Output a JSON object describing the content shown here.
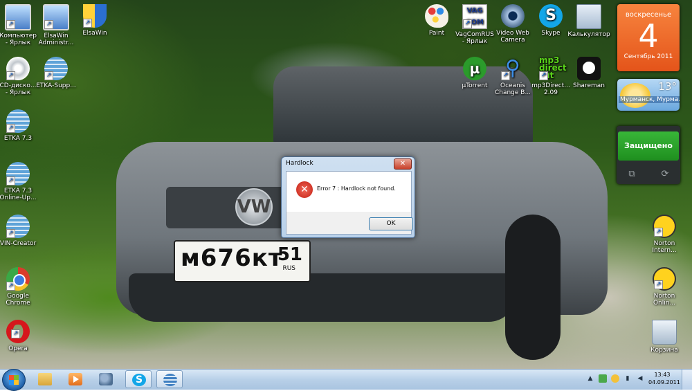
{
  "desktop": {
    "left_icons": [
      {
        "label": "Компьютер\n- Ярлык",
        "icon": "computer-icon"
      },
      {
        "label": "CD-диско...\n- Ярлык",
        "icon": "dvd-icon"
      },
      {
        "label": "ETKA 7.3",
        "icon": "etka-globe-icon"
      },
      {
        "label": "ETKA 7.3\nOnline-Up...",
        "icon": "etka-globe-icon"
      },
      {
        "label": "VIN-Creator",
        "icon": "etka-globe-icon"
      },
      {
        "label": "Google\nChrome",
        "icon": "chrome-icon"
      },
      {
        "label": "Opera",
        "icon": "opera-icon"
      }
    ],
    "elsawin_admin": {
      "label": "ElsaWin\nAdministr...",
      "icon": "elsawin-admin-icon"
    },
    "elsawin": {
      "label": "ElsaWin",
      "icon": "elsawin-shield-icon"
    },
    "etka_supp": {
      "label": "ETKA-Supp...",
      "icon": "etka-globe-icon"
    },
    "top_icons": [
      {
        "label": "Paint",
        "icon": "paint-icon"
      },
      {
        "label": "VagComRUS\n- Ярлык",
        "icon": "vag-icon"
      },
      {
        "label": "Video Web\nCamera",
        "icon": "webcam-icon"
      },
      {
        "label": "Skype",
        "icon": "skype-icon"
      },
      {
        "label": "Калькулятор",
        "icon": "calculator-icon"
      }
    ],
    "second_row_icons": [
      {
        "label": "µTorrent",
        "icon": "utorrent-icon"
      },
      {
        "label": "Oceanis\nChange B...",
        "icon": "oceanis-icon"
      },
      {
        "label": "mp3Direct...\n2.09",
        "icon": "mp3directcut-icon"
      },
      {
        "label": "Shareman",
        "icon": "shareman-icon"
      }
    ],
    "right_icons": [
      {
        "label": "Norton\nIntern...",
        "icon": "norton-internet-icon"
      },
      {
        "label": "Norton\nOnlin...",
        "icon": "norton-online-icon"
      },
      {
        "label": "Корзина",
        "icon": "recycle-bin-icon"
      }
    ],
    "plate": {
      "number": "м676кт",
      "region": "51",
      "country": "RUS"
    }
  },
  "gadgets": {
    "calendar": {
      "weekday": "воскресенье",
      "day": "4",
      "month_year": "Сентябрь 2011"
    },
    "weather": {
      "temperature": "13°",
      "city": "Мурманск, Мурма..."
    },
    "norton": {
      "status": "Защищено"
    }
  },
  "dialog": {
    "title": "Hardlock",
    "message": "Error 7 : Hardlock  not found.",
    "ok_label": "OK",
    "close_glyph": "✕"
  },
  "taskbar": {
    "time": "13:43",
    "date": "04.09.2011",
    "pinned": [
      "explorer",
      "media-player",
      "tools",
      "skype",
      "etka"
    ]
  },
  "colors": {
    "calendar_orange": "#e4541a",
    "norton_green": "#2a9f2a",
    "dialog_frame": "#b9d1ea",
    "error_red": "#c41e12"
  }
}
